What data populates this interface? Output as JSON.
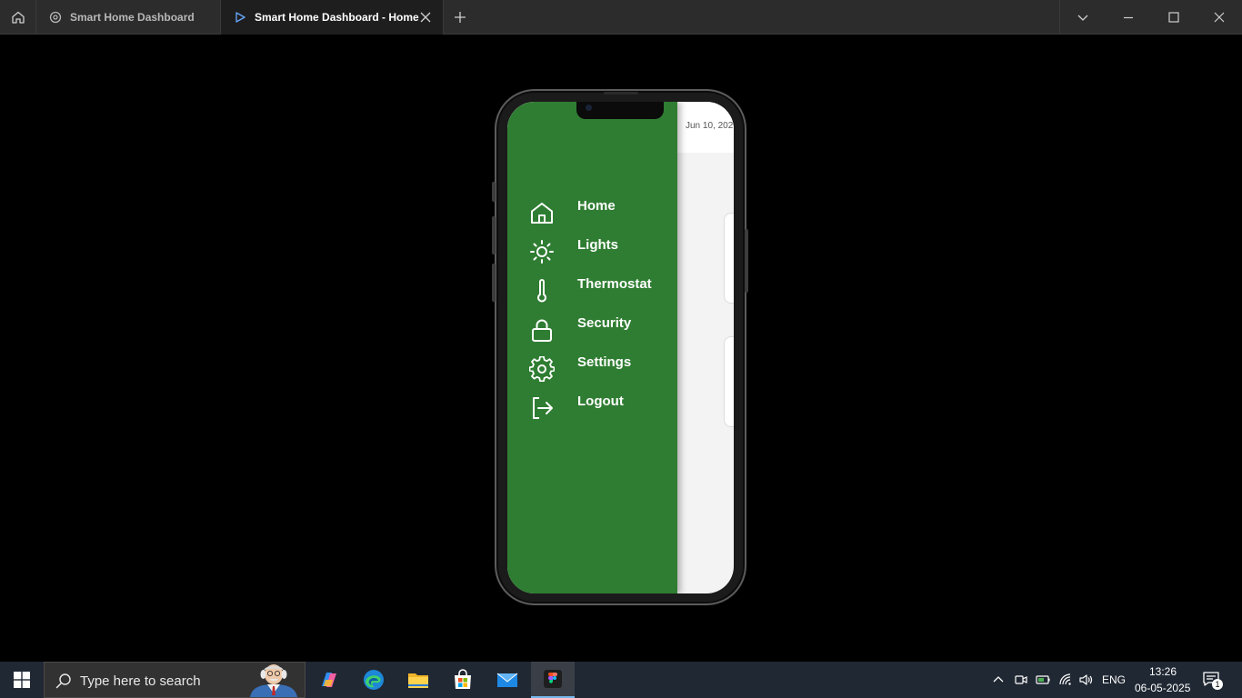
{
  "window": {
    "tabs": [
      {
        "label": "Smart Home Dashboard",
        "active": false
      },
      {
        "label": "Smart Home Dashboard - Home",
        "active": true
      }
    ]
  },
  "app": {
    "date_partial": "Jun 10, 202",
    "drawer_color": "#2f7d32",
    "menu": [
      {
        "label": "Home",
        "icon": "home-icon"
      },
      {
        "label": "Lights",
        "icon": "sun-icon"
      },
      {
        "label": "Thermostat",
        "icon": "thermometer-icon"
      },
      {
        "label": "Security",
        "icon": "lock-icon"
      },
      {
        "label": "Settings",
        "icon": "gear-icon"
      },
      {
        "label": "Logout",
        "icon": "logout-icon"
      }
    ]
  },
  "taskbar": {
    "search_placeholder": "Type here to search",
    "apps": [
      "copilot-icon",
      "edge-icon",
      "file-explorer-icon",
      "store-icon",
      "mail-icon",
      "figma-icon"
    ],
    "tray": {
      "language": "ENG",
      "time": "13:26",
      "date": "06-05-2025",
      "notification_count": "1"
    }
  }
}
